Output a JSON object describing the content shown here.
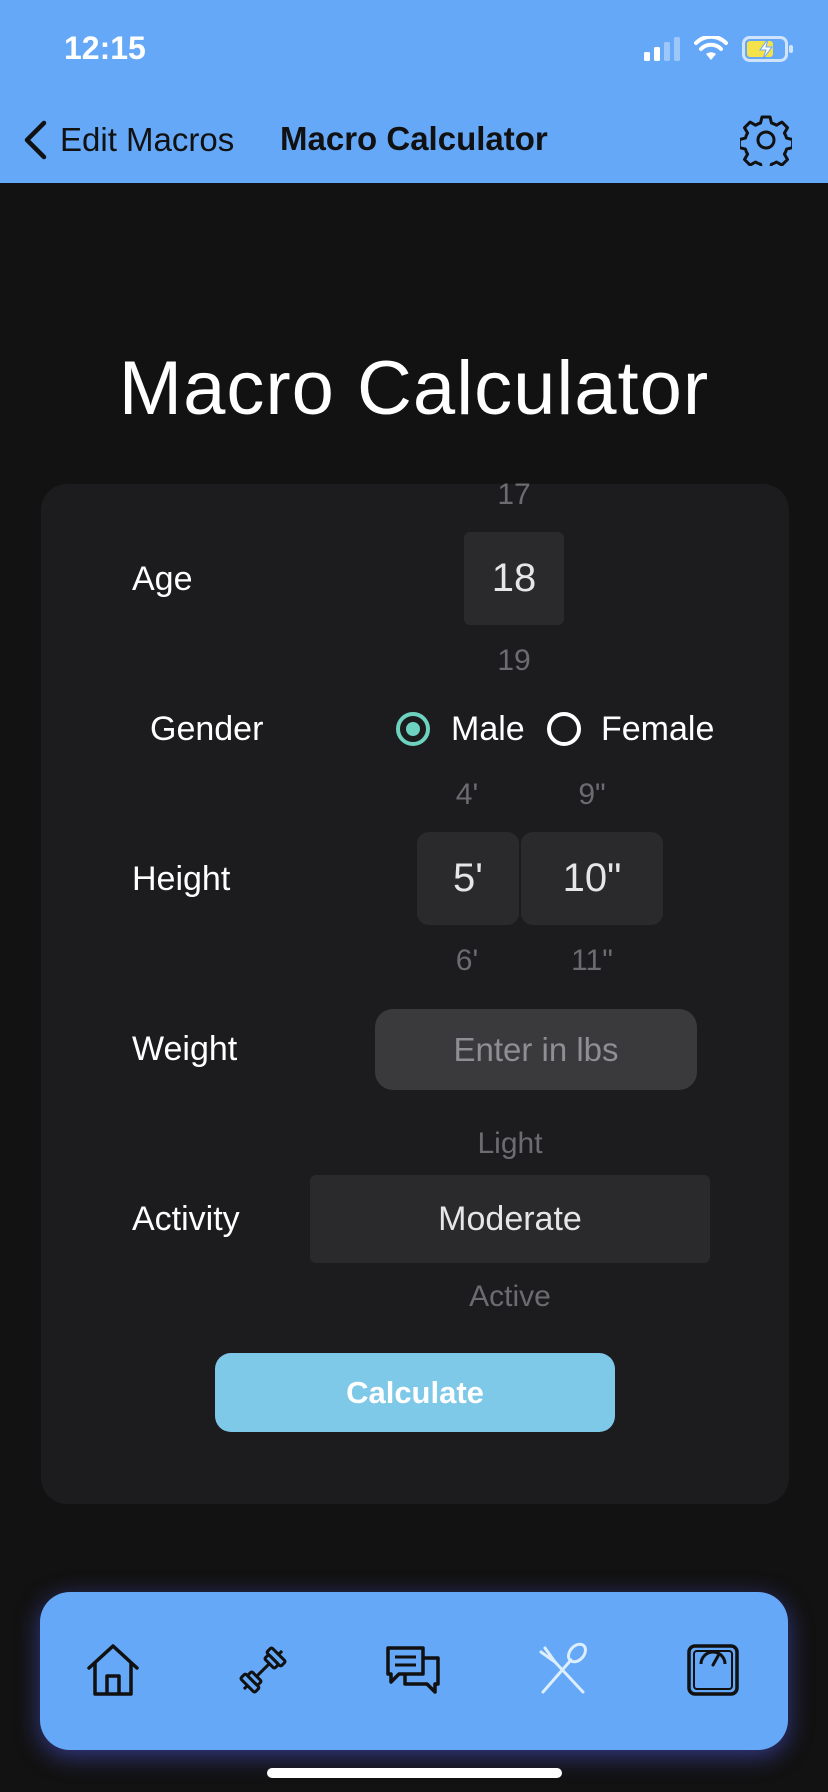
{
  "status_bar": {
    "time": "12:15"
  },
  "nav": {
    "back_label": "Edit Macros",
    "title": "Macro Calculator"
  },
  "page_title": "Macro Calculator",
  "form": {
    "age": {
      "label": "Age",
      "prev": "17",
      "selected": "18",
      "next": "19"
    },
    "gender": {
      "label": "Gender",
      "options": [
        "Male",
        "Female"
      ],
      "selected": "Male"
    },
    "height": {
      "label": "Height",
      "feet": {
        "prev": "4'",
        "selected": "5'",
        "next": "6'"
      },
      "inches": {
        "prev": "9\"",
        "selected": "10\"",
        "next": "11\""
      }
    },
    "weight": {
      "label": "Weight",
      "placeholder": "Enter in lbs",
      "value": ""
    },
    "activity": {
      "label": "Activity",
      "prev": "Light",
      "selected": "Moderate",
      "next": "Active"
    },
    "calculate_label": "Calculate"
  },
  "tabs": [
    "home-icon",
    "dumbbell-icon",
    "chat-icon",
    "utensils-icon",
    "scale-icon"
  ],
  "colors": {
    "header": "#64a8f7",
    "accent": "#6dd3c0",
    "button": "#7ec8e8",
    "card": "#1c1c1e",
    "background": "#121212"
  }
}
